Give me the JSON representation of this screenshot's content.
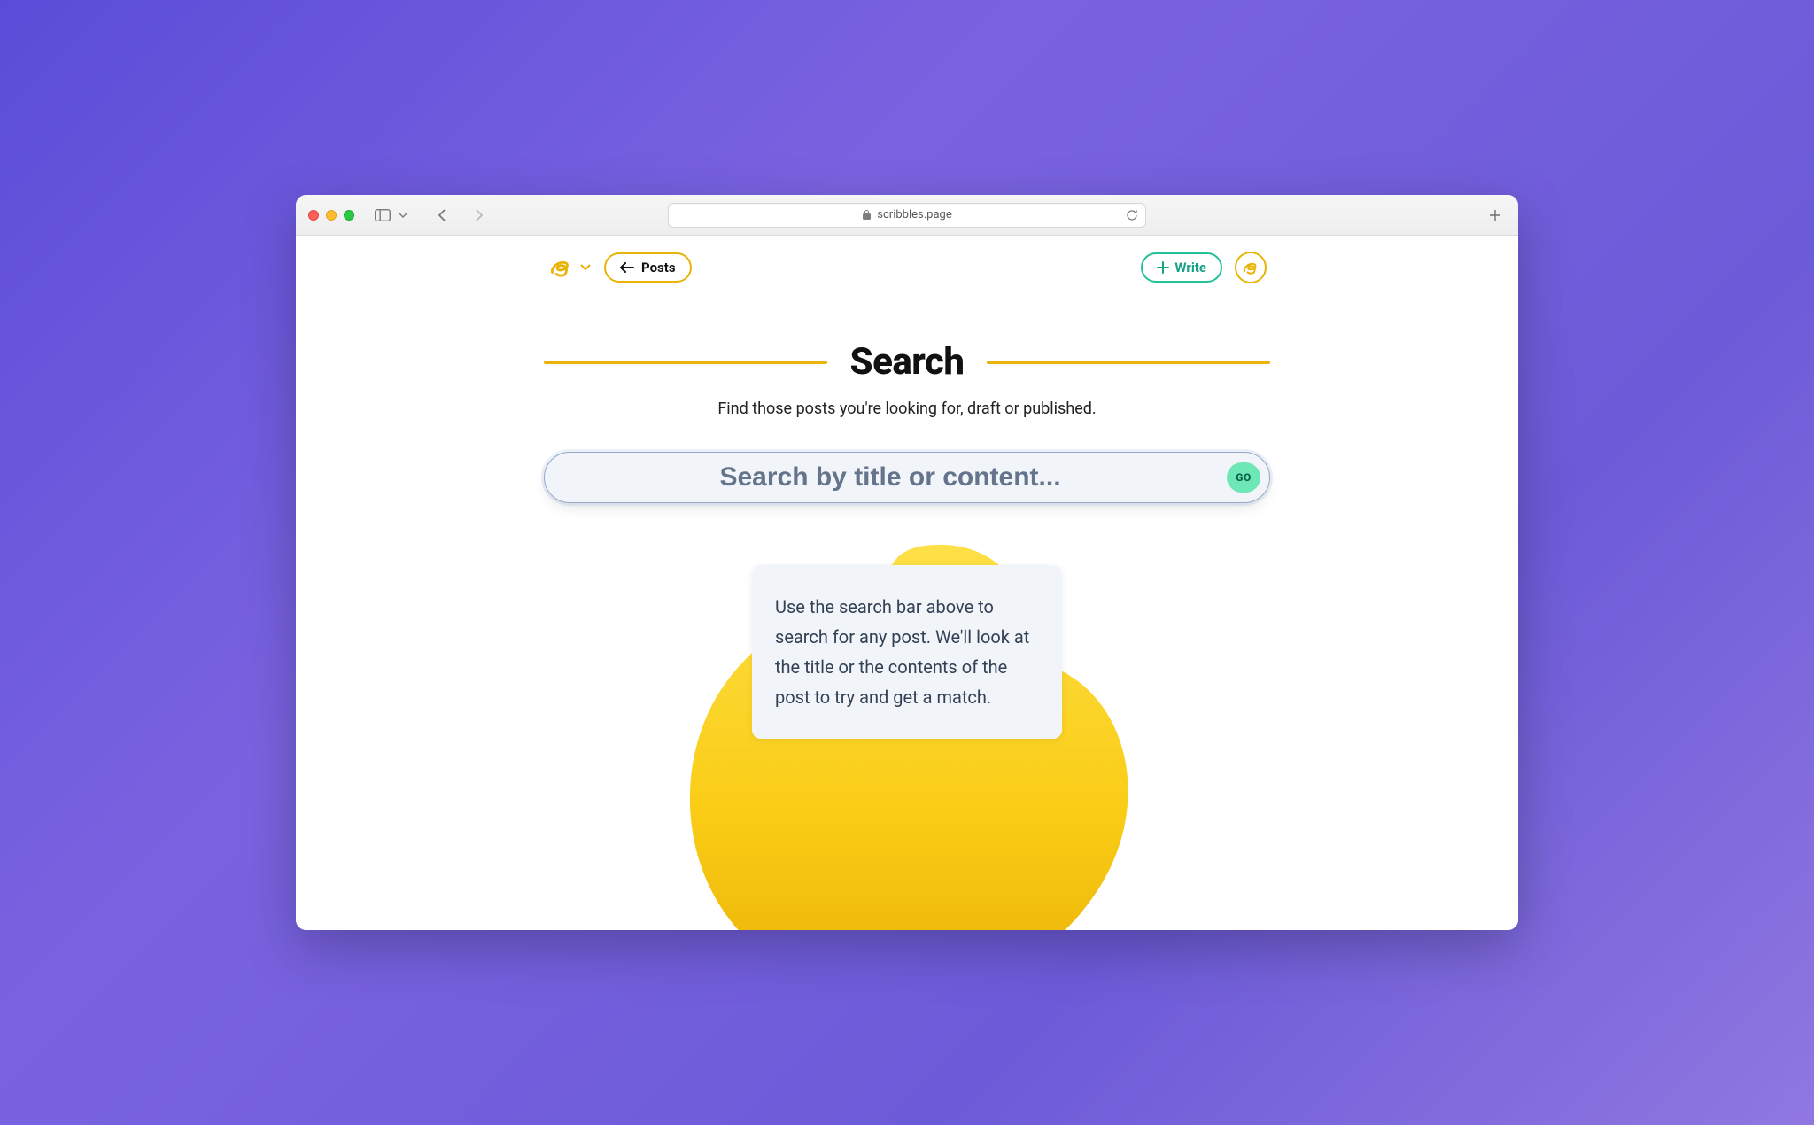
{
  "browser": {
    "url_display": "scribbles.page"
  },
  "nav": {
    "back_label": "Posts",
    "write_label": "Write"
  },
  "hero": {
    "title": "Search",
    "subtitle": "Find those posts you're looking for, draft or published."
  },
  "search": {
    "placeholder": "Search by title or content...",
    "value": "",
    "go_label": "GO"
  },
  "info_card": {
    "text": "Use the search bar above to search for any post. We'll look at the title or the contents of the post to try and get a match."
  },
  "colors": {
    "accent_yellow": "#e9b308",
    "accent_teal": "#22c19a",
    "slate_bg": "#f1f5f9"
  }
}
